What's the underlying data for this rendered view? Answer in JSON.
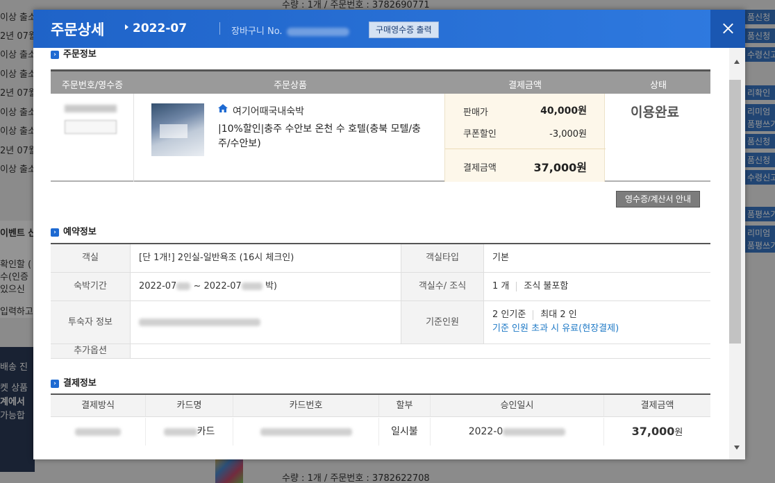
{
  "background": {
    "left_lines": [
      "이상 출소",
      "2년 07월",
      "이상 출소",
      "이상 출소",
      "2년 07월",
      "이상 출소",
      "이상 출소",
      "2년 07월",
      "이상 출소"
    ],
    "right_tabs": [
      "품신청",
      "품신청",
      "수령신고",
      "",
      "리확인",
      "리미엄",
      "품평쓰기",
      "품신청",
      "품신청",
      "수령신고",
      "품평쓰기",
      "리미엄",
      "품평쓰기"
    ],
    "left_notes": [
      "이벤트 산",
      "확인할 (",
      "수(인증",
      "있으신",
      "입력하고",
      "배송 진",
      "켓 상품 ",
      "계에서",
      "가능합"
    ],
    "top_qty": "수량 : 1개 / 주문번호 : 3782690771",
    "bottom_qty": "수량 : 1개 / 주문번호 : 3782622708"
  },
  "modal": {
    "title": "주문상세",
    "date": "2022-07",
    "cart_label": "장바구니 No.",
    "receipt_print_button": "구매영수증 출력",
    "close_label": "close"
  },
  "order_section": {
    "title": "주문정보",
    "headers": [
      "주문번호/영수증",
      "주문상품",
      "결제금액",
      "상태"
    ],
    "shop": "여기어때국내숙박",
    "product_name": "|10%할인|충주 수안보 온천 수 호텔(충북 모텔/충주/수안보)",
    "sale_price_label": "판매가",
    "sale_price": "40,000원",
    "coupon_label": "쿠폰할인",
    "coupon": "-3,000원",
    "paid_label": "결제금액",
    "paid": "37,000원",
    "status": "이용완료",
    "receipt_guide_button": "영수증/계산서 안내"
  },
  "reservation_section": {
    "title": "예약정보",
    "room_label": "객실",
    "room_value": "[단 1개!] 2인실-일반욕조 (16시 체크인)",
    "room_type_label": "객실타입",
    "room_type_value": "기본",
    "period_label": "숙박기간",
    "period_start": "2022-07",
    "period_end": "2022-07",
    "period_suffix": "박)",
    "room_count_label": "객실수/ 조식",
    "room_count": "1 개",
    "breakfast": "조식 불포함",
    "guest_label": "투숙자 정보",
    "base_people_label": "기준인원",
    "base_people": "2 인기준",
    "max_people": "최대 2 인",
    "extra_note": "기준 인원 초과 시 유료(현장결제)",
    "option_label": "추가옵션"
  },
  "payment_section": {
    "title": "결제정보",
    "headers": [
      "결제방식",
      "카드명",
      "카드번호",
      "할부",
      "승인일시",
      "결제금액"
    ],
    "card_suffix": "카드",
    "installment": "일시불",
    "approved": "2022-0",
    "amount_number": "37,000",
    "amount_unit": "원"
  }
}
